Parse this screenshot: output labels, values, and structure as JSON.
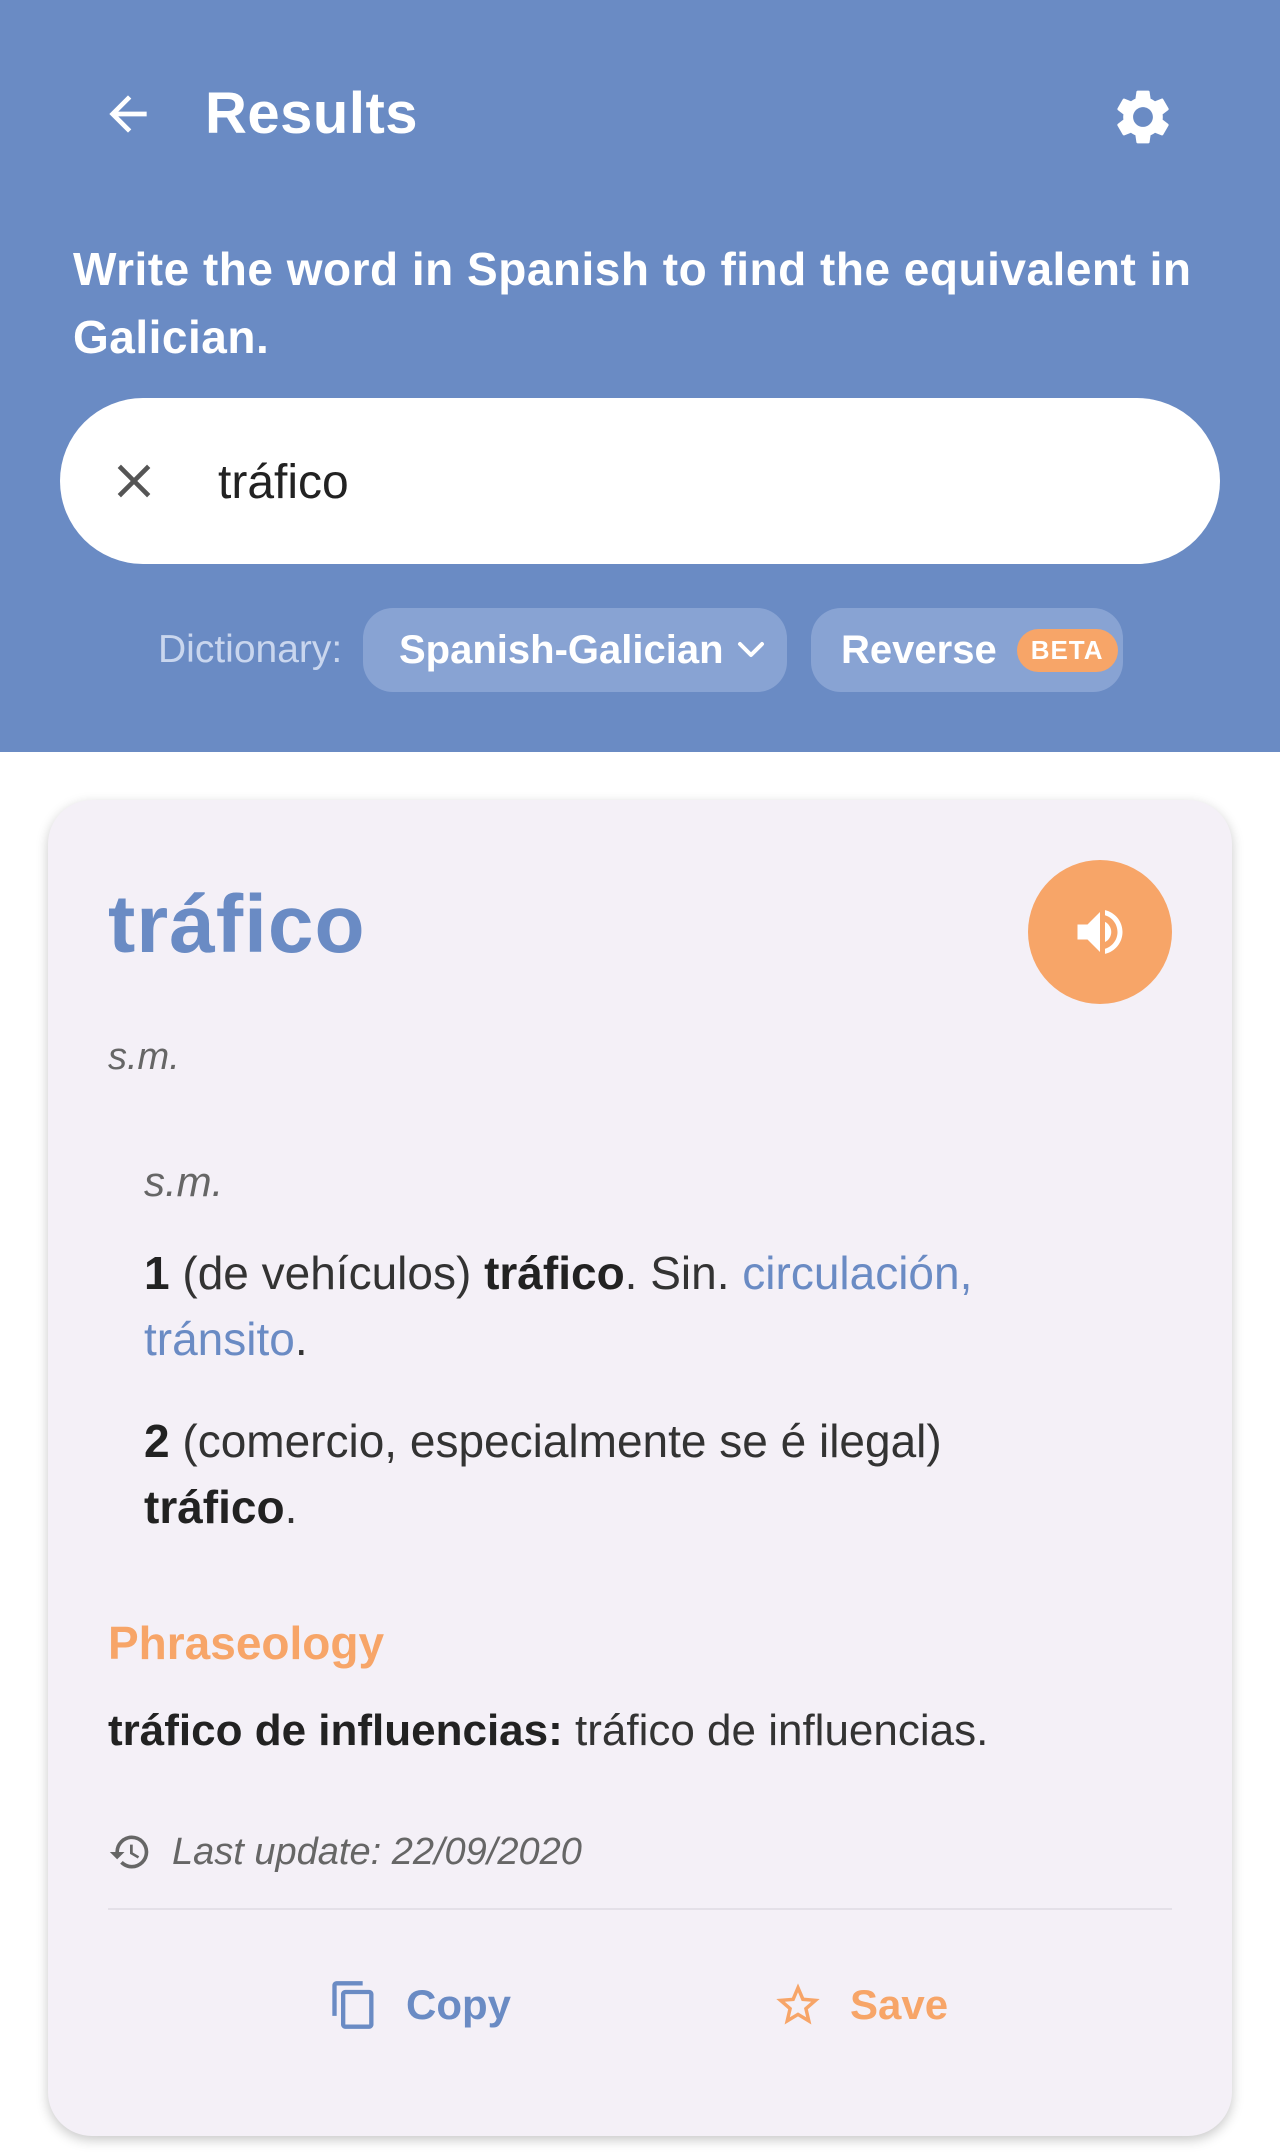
{
  "app": {
    "title": "Results",
    "back_icon": "arrow-back-icon",
    "settings_icon": "gear-icon"
  },
  "search": {
    "instruction": "Write the word in Spanish to find the equivalent in Galician.",
    "value": "tráfico",
    "clear_icon": "close-icon"
  },
  "filters": {
    "dictionary_label": "Dictionary:",
    "dictionary_selected": "Spanish-Galician",
    "reverse_label": "Reverse",
    "reverse_badge": "BETA"
  },
  "entry": {
    "word": "tráfico",
    "pos": "s.m.",
    "sub_pos": "s.m.",
    "senses": [
      {
        "number": "1",
        "context": "(de vehículos)",
        "translation": "tráfico",
        "synonyms_prefix": "Sin.",
        "synonyms": "circulación, tránsito"
      },
      {
        "number": "2",
        "context": "(comercio, especialmente se é ilegal)",
        "translation": "tráfico"
      }
    ],
    "phraseology_title": "Phraseology",
    "phrase": {
      "term": "tráfico de influencias:",
      "translation": "tráfico de influencias."
    },
    "last_update": "Last update: 22/09/2020",
    "copy_label": "Copy",
    "save_label": "Save"
  },
  "colors": {
    "primary": "#6a8bc4",
    "accent": "#f7a568",
    "card_bg": "#f4f0f7"
  }
}
